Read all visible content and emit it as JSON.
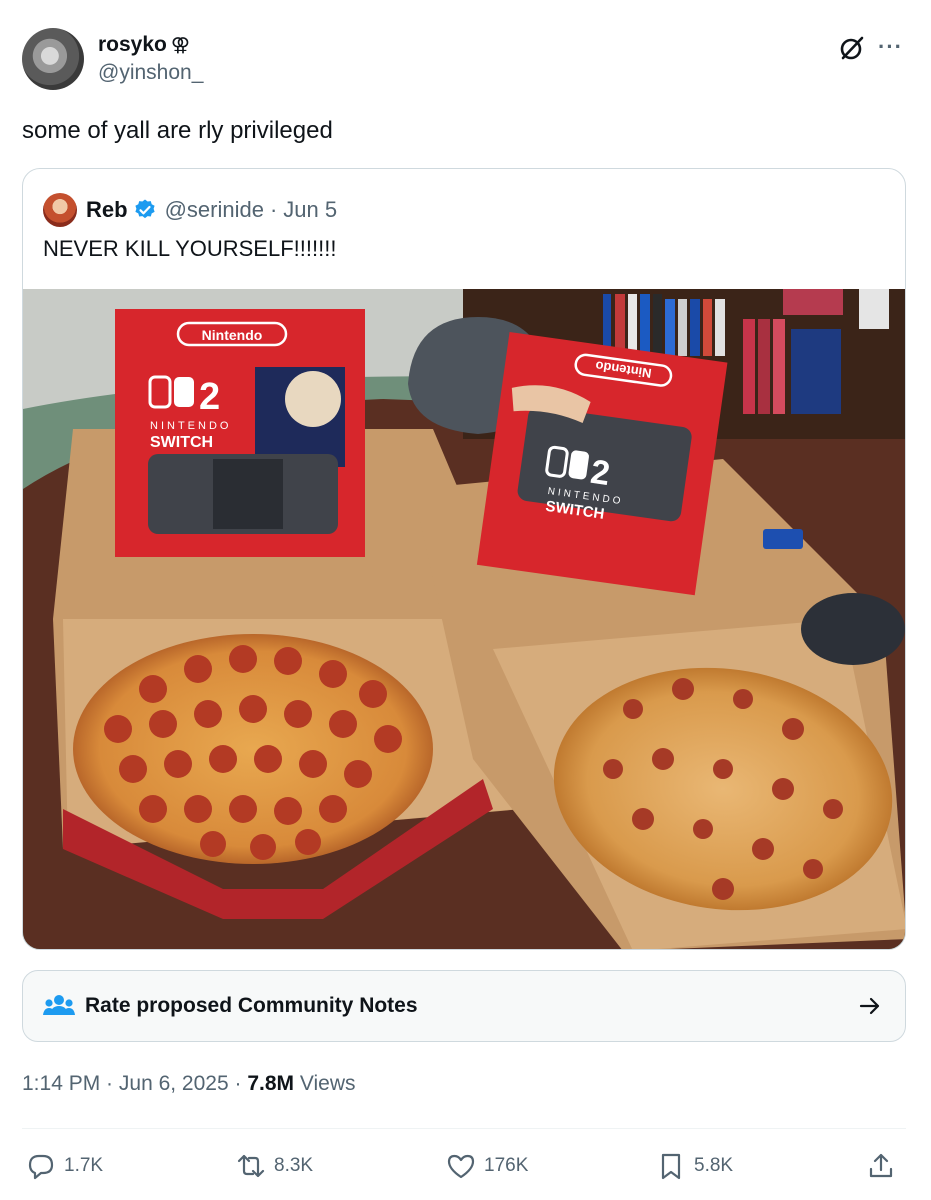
{
  "author": {
    "display_name": "rosyko",
    "badge_glyph": "⚢",
    "handle": "@yinshon_"
  },
  "tweet": {
    "text": "some of yall are rly privileged"
  },
  "quoted": {
    "display_name": "Reb",
    "handle": "@serinide",
    "separator": "·",
    "date": "Jun 5",
    "text": "NEVER KILL YOURSELF!!!!!!!",
    "media": {
      "box_logo_left": "Nintendo",
      "box_logo_right": "Nintendo",
      "box_model": "2",
      "box_brand_top": "NINTENDO",
      "box_brand_bottom": "SWITCH"
    }
  },
  "community_notes": {
    "label": "Rate proposed Community Notes"
  },
  "meta": {
    "time": "1:14 PM",
    "sep1": " · ",
    "date": "Jun 6, 2025",
    "sep2": " · ",
    "views_count": "7.8M",
    "views_label": " Views"
  },
  "actions": {
    "replies": "1.7K",
    "reposts": "8.3K",
    "likes": "176K",
    "bookmarks": "5.8K"
  },
  "colors": {
    "text": "#0f1419",
    "secondary": "#536471",
    "border": "#cfd9de",
    "verified": "#1d9bf0",
    "notes_icon": "#1d9bf0",
    "box_red": "#d7262c"
  }
}
